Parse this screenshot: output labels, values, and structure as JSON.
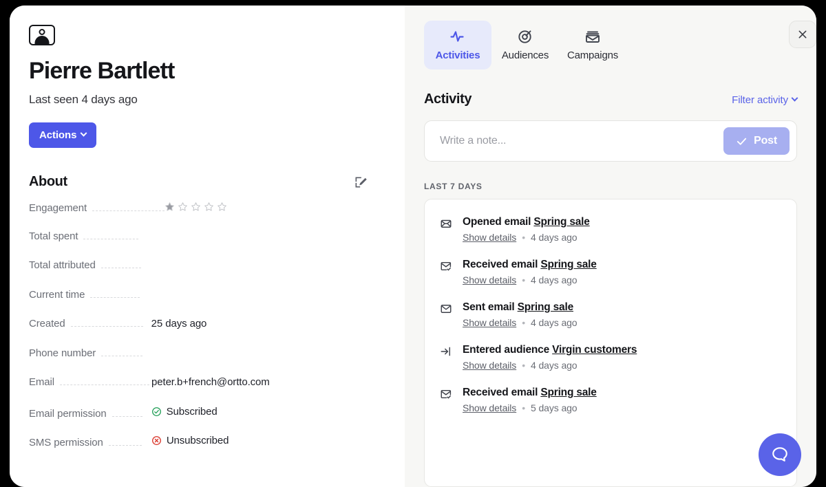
{
  "profile": {
    "avatar_icon": "person-avatar-icon",
    "name": "Pierre Bartlett",
    "last_seen": "Last seen 4 days ago",
    "actions_label": "Actions"
  },
  "about": {
    "title": "About",
    "edit_icon": "edit-pencil-icon",
    "rows": [
      {
        "label": "Engagement",
        "value": "",
        "type": "stars",
        "stars_filled": 1,
        "stars_total": 5,
        "leader_width": 105
      },
      {
        "label": "Total spent",
        "value": "",
        "type": "text",
        "leader_width": 80
      },
      {
        "label": "Total attributed",
        "value": "",
        "type": "text",
        "leader_width": 58
      },
      {
        "label": "Current time",
        "value": "",
        "type": "text",
        "leader_width": 72
      },
      {
        "label": "Created",
        "value": "25 days ago",
        "type": "text",
        "leader_width": 105
      },
      {
        "label": "Phone number",
        "value": "",
        "type": "text",
        "leader_width": 60
      },
      {
        "label": "Email",
        "value": "peter.b+french@ortto.com",
        "type": "text",
        "leader_width": 130
      },
      {
        "label": "Email permission",
        "value": "Subscribed",
        "type": "status",
        "status": "subscribed",
        "status_color": "#1f9d55",
        "leader_width": 44
      },
      {
        "label": "SMS permission",
        "value": "Unsubscribed",
        "type": "status",
        "status": "unsubscribed",
        "status_color": "#d93025",
        "leader_width": 48
      }
    ]
  },
  "tabs": [
    {
      "label": "Activities",
      "icon": "pulse-activity-icon",
      "active": true
    },
    {
      "label": "Audiences",
      "icon": "target-bullseye-icon",
      "active": false
    },
    {
      "label": "Campaigns",
      "icon": "envelope-stack-icon",
      "active": false
    }
  ],
  "close_icon": "close-icon",
  "activity": {
    "title": "Activity",
    "filter_label": "Filter activity",
    "note_placeholder": "Write a note...",
    "note_value": "",
    "post_label": "Post",
    "section_label": "LAST 7 DAYS",
    "items": [
      {
        "icon": "envelope-open-icon",
        "action": "Opened email ",
        "object": "Spring sale",
        "details_label": "Show details",
        "time": "4 days ago"
      },
      {
        "icon": "envelope-check-icon",
        "action": "Received email ",
        "object": "Spring sale",
        "details_label": "Show details",
        "time": "4 days ago"
      },
      {
        "icon": "envelope-icon",
        "action": "Sent email ",
        "object": "Spring sale",
        "details_label": "Show details",
        "time": "4 days ago"
      },
      {
        "icon": "enter-arrow-icon",
        "action": "Entered audience ",
        "object": "Virgin customers",
        "details_label": "Show details",
        "time": "4 days ago"
      },
      {
        "icon": "envelope-check-icon",
        "action": "Received email ",
        "object": "Spring sale",
        "details_label": "Show details",
        "time": "5 days ago"
      }
    ]
  },
  "chat_widget": {
    "icon": "chat-bubble-icon",
    "color": "#5a63e8"
  },
  "colors": {
    "accent": "#4d57e8",
    "accent_soft": "#a7aff0",
    "tab_active_bg": "#e7eafb",
    "panel_bg": "#f7f7f5"
  }
}
